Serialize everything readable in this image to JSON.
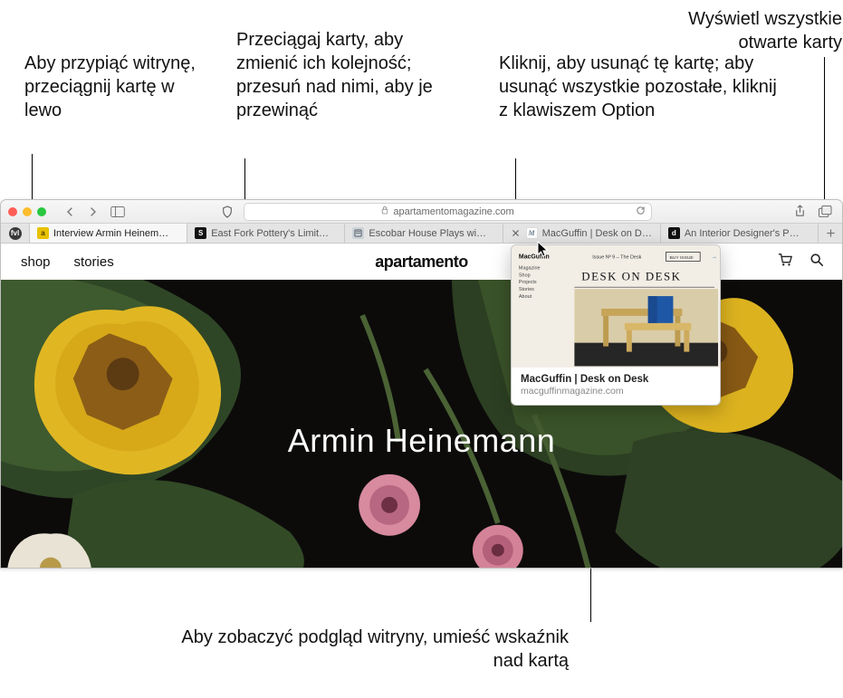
{
  "callouts": {
    "pin": "Aby przypiąć witrynę, przeciągnij kartę w lewo",
    "drag": "Przeciągaj karty, aby zmienić ich kolejność; przesuń nad nimi, aby je przewinąć",
    "close": "Kliknij, aby usunąć tę kartę; aby usunąć wszystkie pozostałe, kliknij z klawiszem Option",
    "show_all": "Wyświetl wszystkie otwarte karty",
    "preview": "Aby zobaczyć podgląd witryny, umieść wskaźnik nad kartą"
  },
  "toolbar": {
    "url": "apartamentomagazine.com"
  },
  "pinned_tab_label": "fvl",
  "tabs": [
    {
      "label": "Interview Armin Heinem…",
      "fav_bg": "#e7c100",
      "fav_txt": "a",
      "fav_color": "#4a3a00",
      "active": true
    },
    {
      "label": "East Fork Pottery's Limit…",
      "fav_bg": "#111",
      "fav_txt": "S",
      "fav_color": "#fff"
    },
    {
      "label": "Escobar House Plays wi…",
      "fav_bg": "#cbd3d7",
      "fav_txt": "",
      "fav_color": "#556",
      "icon": "news"
    },
    {
      "label": "MacGuffin | Desk on De…",
      "fav_bg": "#fff",
      "fav_txt": "M",
      "fav_color": "#6a7a88",
      "hovered": true,
      "script": true
    },
    {
      "label": "An Interior Designer's P…",
      "fav_bg": "#111",
      "fav_txt": "d",
      "fav_color": "#fff"
    }
  ],
  "page": {
    "nav": {
      "shop": "shop",
      "stories": "stories",
      "brand": "apartamento"
    },
    "hero_title": "Armin Heinemann"
  },
  "preview": {
    "title": "MacGuffin | Desk on Desk",
    "domain": "macguffinmagazine.com",
    "thumb": {
      "issue": "Issue Nº 9 – The Desk",
      "buy": "BUY ISSUE",
      "brand": "MacGuffin",
      "nav": [
        "Magazine",
        "Shop",
        "Projects",
        "Stories",
        "About"
      ],
      "headline": "DESK ON DESK"
    }
  }
}
